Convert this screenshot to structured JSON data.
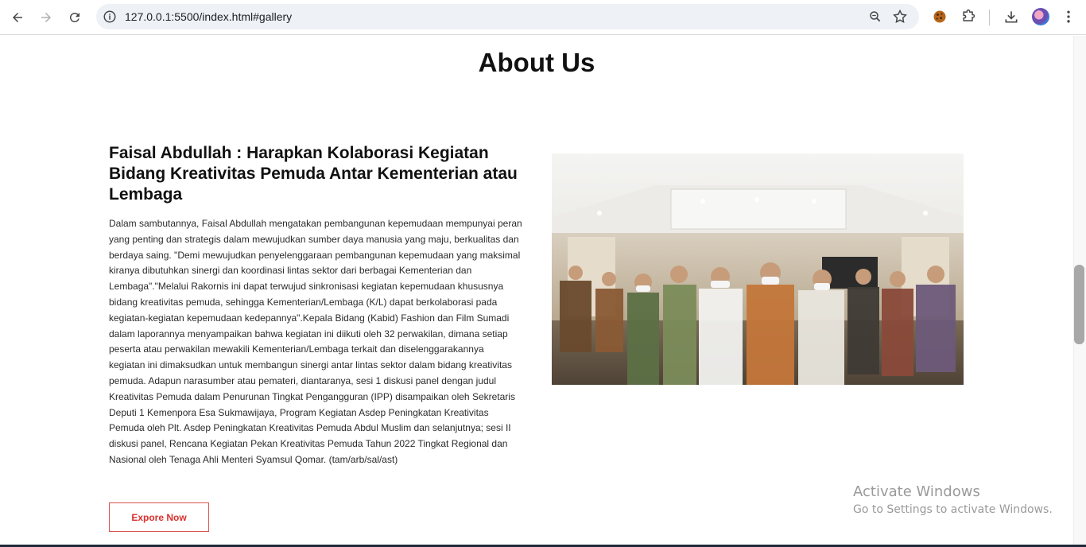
{
  "browser": {
    "url": "127.0.0.1:5500/index.html#gallery",
    "icons": [
      "back-arrow-icon",
      "forward-arrow-icon",
      "reload-icon",
      "site-info-icon",
      "zoom-icon",
      "bookmark-star-icon",
      "cookie-extension-icon",
      "extensions-puzzle-icon",
      "download-icon",
      "profile-avatar",
      "more-menu-icon"
    ]
  },
  "section": {
    "title": "About Us"
  },
  "article": {
    "title": "Faisal Abdullah : Harapkan Kolaborasi Kegiatan Bidang Kreativitas Pemuda Antar Kementerian atau Lembaga",
    "body": "Dalam sambutannya, Faisal Abdullah mengatakan pembangunan kepemudaan mempunyai peran yang penting dan strategis dalam mewujudkan sumber daya manusia yang maju, berkualitas dan berdaya saing. \"Demi mewujudkan penyelenggaraan pembangunan kepemudaan yang maksimal kiranya dibutuhkan sinergi dan koordinasi lintas sektor dari berbagai Kementerian dan Lembaga\".\"Melalui Rakornis ini dapat terwujud sinkronisasi kegiatan kepemudaan khususnya bidang kreativitas pemuda, sehingga Kementerian/Lembaga (K/L) dapat berkolaborasi pada kegiatan-kegiatan kepemudaan kedepannya\".Kepala Bidang (Kabid) Fashion dan Film Sumadi dalam laporannya menyampaikan bahwa kegiatan ini diikuti oleh 32 perwakilan, dimana setiap peserta atau perwakilan mewakili Kementerian/Lembaga terkait dan diselenggarakannya kegiatan ini dimaksudkan untuk membangun sinergi antar lintas sektor dalam bidang kreativitas pemuda. Adapun narasumber atau pemateri, diantaranya, sesi 1 diskusi panel dengan judul Kreativitas Pemuda dalam Penurunan Tingkat Pengangguran (IPP) disampaikan oleh Sekretaris Deputi 1 Kemenpora Esa Sukmawijaya, Program Kegiatan Asdep Peningkatan Kreativitas Pemuda oleh Plt. Asdep Peningkatan Kreativitas Pemuda Abdul Muslim dan selanjutnya; sesi II diskusi panel, Rencana Kegiatan Pekan Kreativitas Pemuda Tahun 2022 Tingkat Regional dan Nasional oleh Tenaga Ahli Menteri Syamsul Qomar. (tam/arb/sal/ast)",
    "button_label": "Expore Now"
  },
  "watermark": {
    "line1": "Activate Windows",
    "line2": "Go to Settings to activate Windows."
  },
  "colors": {
    "accent": "#d9302c",
    "text": "#111111"
  }
}
